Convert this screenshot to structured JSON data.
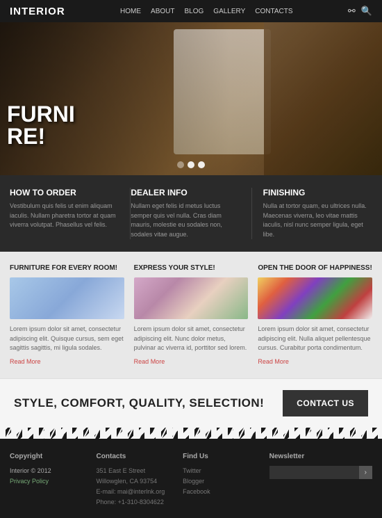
{
  "navbar": {
    "brand": "INTERIOR",
    "menu": [
      "HOME",
      "ABOUT",
      "BLOG",
      "GALLERY",
      "CONTACTS"
    ]
  },
  "hero": {
    "line1": "",
    "line2": "RE!",
    "dots": [
      false,
      true,
      true
    ]
  },
  "info_strip": {
    "cols": [
      {
        "title": "HOW TO ORDER",
        "text": "Vestibulum quis felis ut enim aliquam iaculis. Nullam pharetra tortor at quam viverra volutpat. Phasellus vel felis."
      },
      {
        "title": "DEALER INFO",
        "text": "Nullam eget felis id metus luctus semper quis vel nulla. Cras diam mauris, molestie eu sodales non, sodales vitae augue."
      },
      {
        "title": "FINISHING",
        "text": "Nulla at tortor quam, eu ultrices nulla. Maecenas viverra, leo vitae mattis iaculis, nisl nunc semper ligula, eget libe."
      }
    ]
  },
  "features": {
    "cols": [
      {
        "title": "FURNITURE FOR EVERY ROOM!",
        "text": "Lorem ipsum dolor sit amet, consectetur adipiscing elit. Quisque cursus, sem eget sagittis sagittis, mi ligula sodales.",
        "read_more": "Read More"
      },
      {
        "title": "EXPRESS YOUR STYLE!",
        "text": "Lorem ipsum dolor sit amet, consectetur adipiscing elit. Nunc dolor metus, pulvinar ac viverra id, porttitor sed lorem.",
        "read_more": "Read More"
      },
      {
        "title": "OPEN THE DOOR OF HAPPINESS!",
        "text": "Lorem ipsum dolor sit amet, consectetur adipiscing elit. Nulla aliquet pellentesque cursus. Curabitur porta condimentum.",
        "read_more": "Read More"
      }
    ]
  },
  "cta": {
    "text": "STYLE, COMFORT, QUALITY, SELECTION!",
    "button": "CONTACT US"
  },
  "footer": {
    "copyright": {
      "heading": "Copyright",
      "brand": "Interior © 2012",
      "privacy": "Privacy Policy"
    },
    "contacts": {
      "heading": "Contacts",
      "address": "351 East E Street",
      "city": "Willowglen, CA 93754",
      "email": "E-mail: mai@interlnk.org",
      "phone": "Phone: +1-310-8304622"
    },
    "find_us": {
      "heading": "Find Us",
      "links": [
        "Twitter",
        "Blogger",
        "Facebook"
      ]
    },
    "newsletter": {
      "heading": "Newsletter",
      "placeholder": "",
      "button": "›"
    }
  }
}
